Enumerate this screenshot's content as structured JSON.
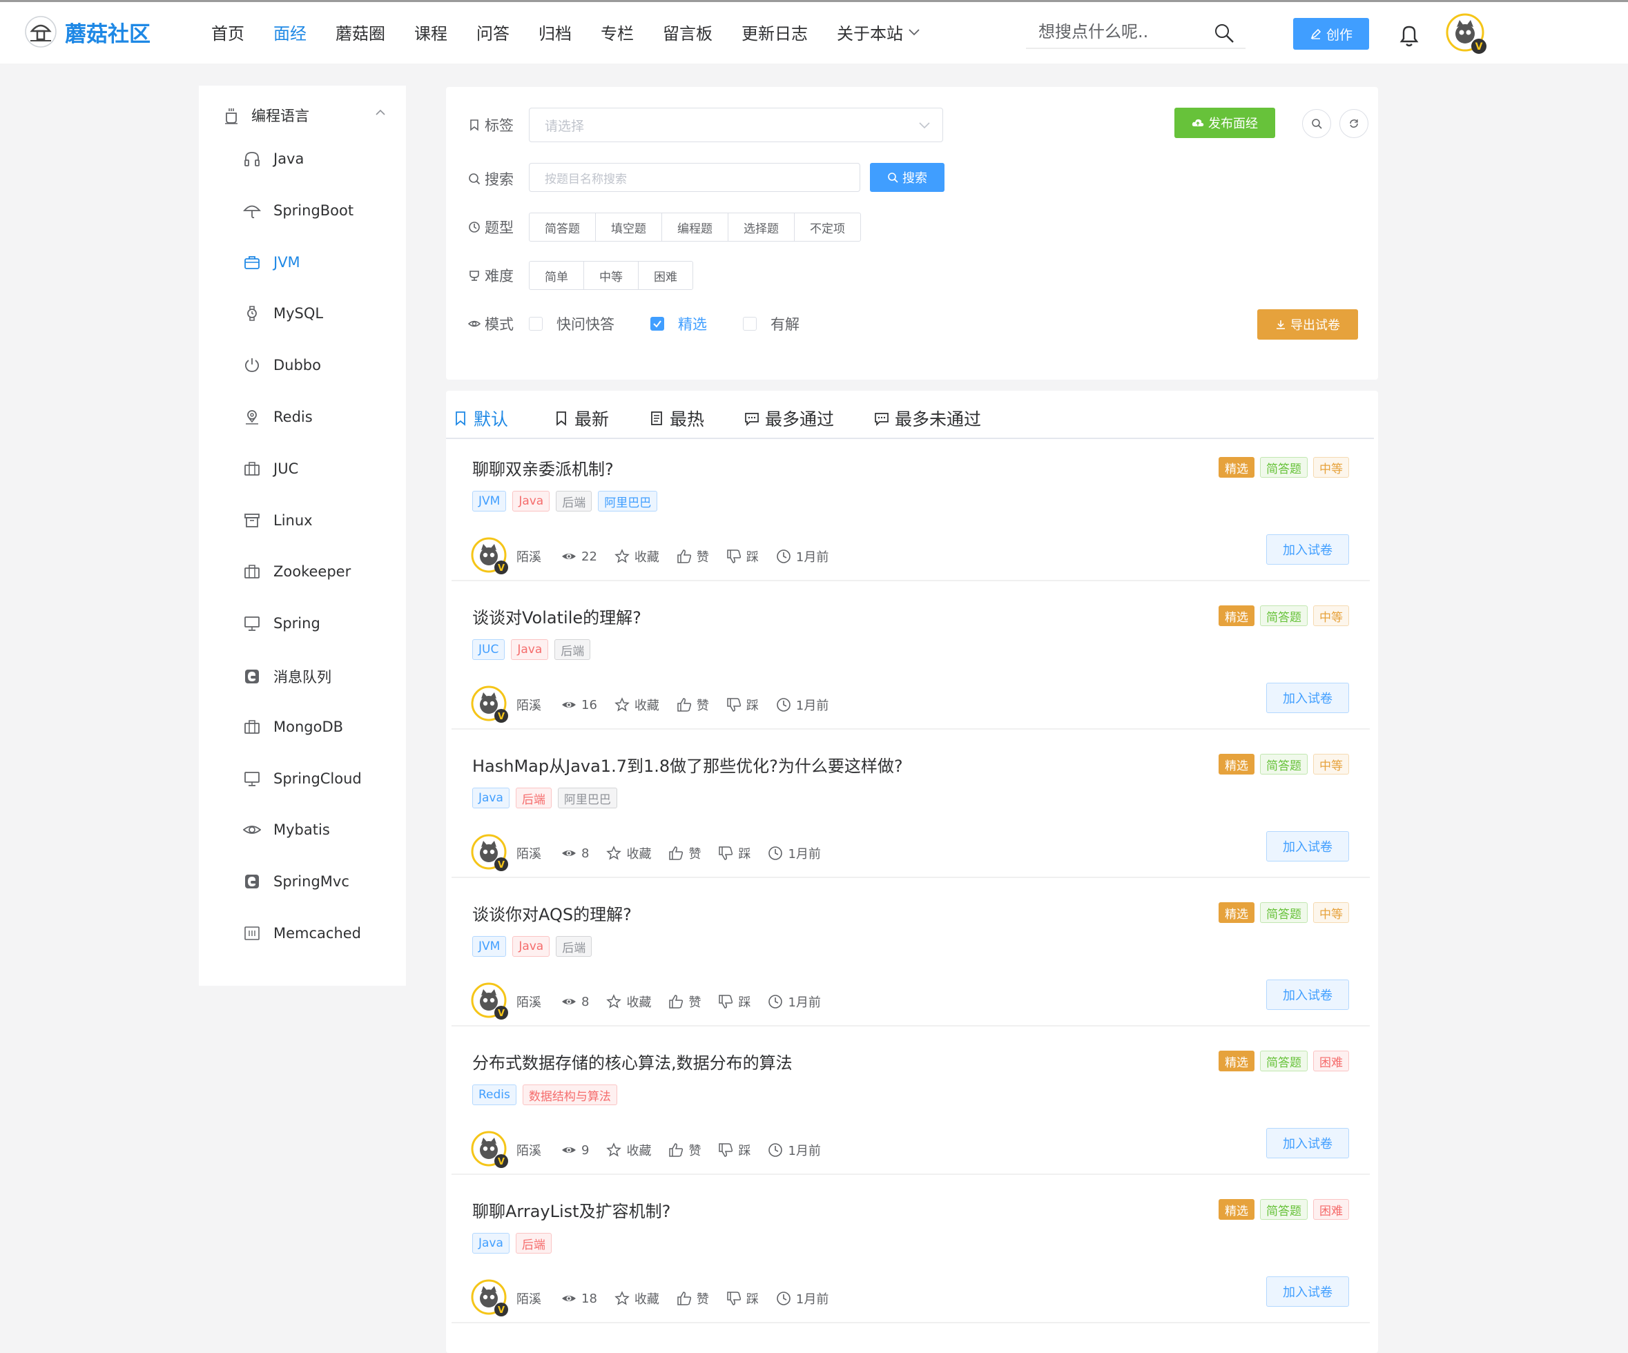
{
  "header": {
    "logo_text": "蘑菇社区",
    "nav": [
      {
        "label": "首页"
      },
      {
        "label": "面经",
        "active": true
      },
      {
        "label": "蘑菇圈"
      },
      {
        "label": "课程"
      },
      {
        "label": "问答"
      },
      {
        "label": "归档"
      },
      {
        "label": "专栏"
      },
      {
        "label": "留言板"
      },
      {
        "label": "更新日志"
      },
      {
        "label": "关于本站"
      }
    ],
    "search_placeholder": "想搜点什么呢..",
    "create_label": "创作",
    "avatar_badge": "V"
  },
  "sidebar": {
    "heading": "编程语言",
    "items": [
      {
        "label": "Java",
        "icon": "headphones-icon"
      },
      {
        "label": "SpringBoot",
        "icon": "umbrella-icon"
      },
      {
        "label": "JVM",
        "icon": "briefcase-icon",
        "active": true
      },
      {
        "label": "MySQL",
        "icon": "watch-icon"
      },
      {
        "label": "Dubbo",
        "icon": "power-icon"
      },
      {
        "label": "Redis",
        "icon": "location-icon"
      },
      {
        "label": "JUC",
        "icon": "suitcase-icon"
      },
      {
        "label": "Linux",
        "icon": "box-icon"
      },
      {
        "label": "Zookeeper",
        "icon": "suitcase-icon"
      },
      {
        "label": "Spring",
        "icon": "monitor-icon"
      },
      {
        "label": "消息队列",
        "icon": "edge-icon"
      },
      {
        "label": "MongoDB",
        "icon": "suitcase-icon"
      },
      {
        "label": "SpringCloud",
        "icon": "monitor-icon"
      },
      {
        "label": "Mybatis",
        "icon": "eye-icon"
      },
      {
        "label": "SpringMvc",
        "icon": "edge-icon"
      },
      {
        "label": "Memcached",
        "icon": "panel-icon"
      }
    ]
  },
  "filter": {
    "tag_label": "标签",
    "tag_placeholder": "请选择",
    "search_label": "搜索",
    "search_placeholder": "按题目名称搜索",
    "search_button": "搜索",
    "type_label": "题型",
    "types": [
      "简答题",
      "填空题",
      "编程题",
      "选择题",
      "不定项"
    ],
    "difficulty_label": "难度",
    "difficulties": [
      "简单",
      "中等",
      "困难"
    ],
    "mode_label": "模式",
    "modes": [
      {
        "label": "快问快答",
        "checked": false
      },
      {
        "label": "精选",
        "checked": true
      },
      {
        "label": "有解",
        "checked": false
      }
    ],
    "publish_button": "发布面经",
    "export_button": "导出试卷"
  },
  "tabs": [
    {
      "label": "默认",
      "active": true
    },
    {
      "label": "最新"
    },
    {
      "label": "最热"
    },
    {
      "label": "最多通过"
    },
    {
      "label": "最多未通过"
    }
  ],
  "colors": {
    "accent": "#1e88e5",
    "primary": "#409eff",
    "success": "#67c23a",
    "warning": "#e6a23c",
    "danger": "#f56c6c"
  },
  "questions": [
    {
      "title": "聊聊双亲委派机制?",
      "tags": [
        {
          "t": "JVM",
          "c": "blue"
        },
        {
          "t": "Java",
          "c": "red"
        },
        {
          "t": "后端",
          "c": "gray"
        },
        {
          "t": "阿里巴巴",
          "c": "blue"
        }
      ],
      "featured": "精选",
      "qtype": "简答题",
      "level": "中等",
      "level_color": "mid",
      "author": "陌溪",
      "views": "22",
      "collect": "收藏",
      "like": "赞",
      "dislike": "踩",
      "time": "1月前",
      "add": "加入试卷"
    },
    {
      "title": "谈谈对Volatile的理解?",
      "tags": [
        {
          "t": "JUC",
          "c": "blue"
        },
        {
          "t": "Java",
          "c": "red"
        },
        {
          "t": "后端",
          "c": "gray"
        }
      ],
      "featured": "精选",
      "qtype": "简答题",
      "level": "中等",
      "level_color": "mid",
      "author": "陌溪",
      "views": "16",
      "collect": "收藏",
      "like": "赞",
      "dislike": "踩",
      "time": "1月前",
      "add": "加入试卷"
    },
    {
      "title": "HashMap从Java1.7到1.8做了那些优化?为什么要这样做?",
      "tags": [
        {
          "t": "Java",
          "c": "blue"
        },
        {
          "t": "后端",
          "c": "red"
        },
        {
          "t": "阿里巴巴",
          "c": "gray"
        }
      ],
      "featured": "精选",
      "qtype": "简答题",
      "level": "中等",
      "level_color": "mid",
      "author": "陌溪",
      "views": "8",
      "collect": "收藏",
      "like": "赞",
      "dislike": "踩",
      "time": "1月前",
      "add": "加入试卷"
    },
    {
      "title": "谈谈你对AQS的理解?",
      "tags": [
        {
          "t": "JVM",
          "c": "blue"
        },
        {
          "t": "Java",
          "c": "red"
        },
        {
          "t": "后端",
          "c": "gray"
        }
      ],
      "featured": "精选",
      "qtype": "简答题",
      "level": "中等",
      "level_color": "mid",
      "author": "陌溪",
      "views": "8",
      "collect": "收藏",
      "like": "赞",
      "dislike": "踩",
      "time": "1月前",
      "add": "加入试卷"
    },
    {
      "title": "分布式数据存储的核心算法,数据分布的算法",
      "tags": [
        {
          "t": "Redis",
          "c": "blue"
        },
        {
          "t": "数据结构与算法",
          "c": "red"
        }
      ],
      "featured": "精选",
      "qtype": "简答题",
      "level": "困难",
      "level_color": "hard",
      "author": "陌溪",
      "views": "9",
      "collect": "收藏",
      "like": "赞",
      "dislike": "踩",
      "time": "1月前",
      "add": "加入试卷"
    },
    {
      "title": "聊聊ArrayList及扩容机制?",
      "tags": [
        {
          "t": "Java",
          "c": "blue"
        },
        {
          "t": "后端",
          "c": "red"
        }
      ],
      "featured": "精选",
      "qtype": "简答题",
      "level": "困难",
      "level_color": "hard",
      "author": "陌溪",
      "views": "18",
      "collect": "收藏",
      "like": "赞",
      "dislike": "踩",
      "time": "1月前",
      "add": "加入试卷"
    }
  ]
}
